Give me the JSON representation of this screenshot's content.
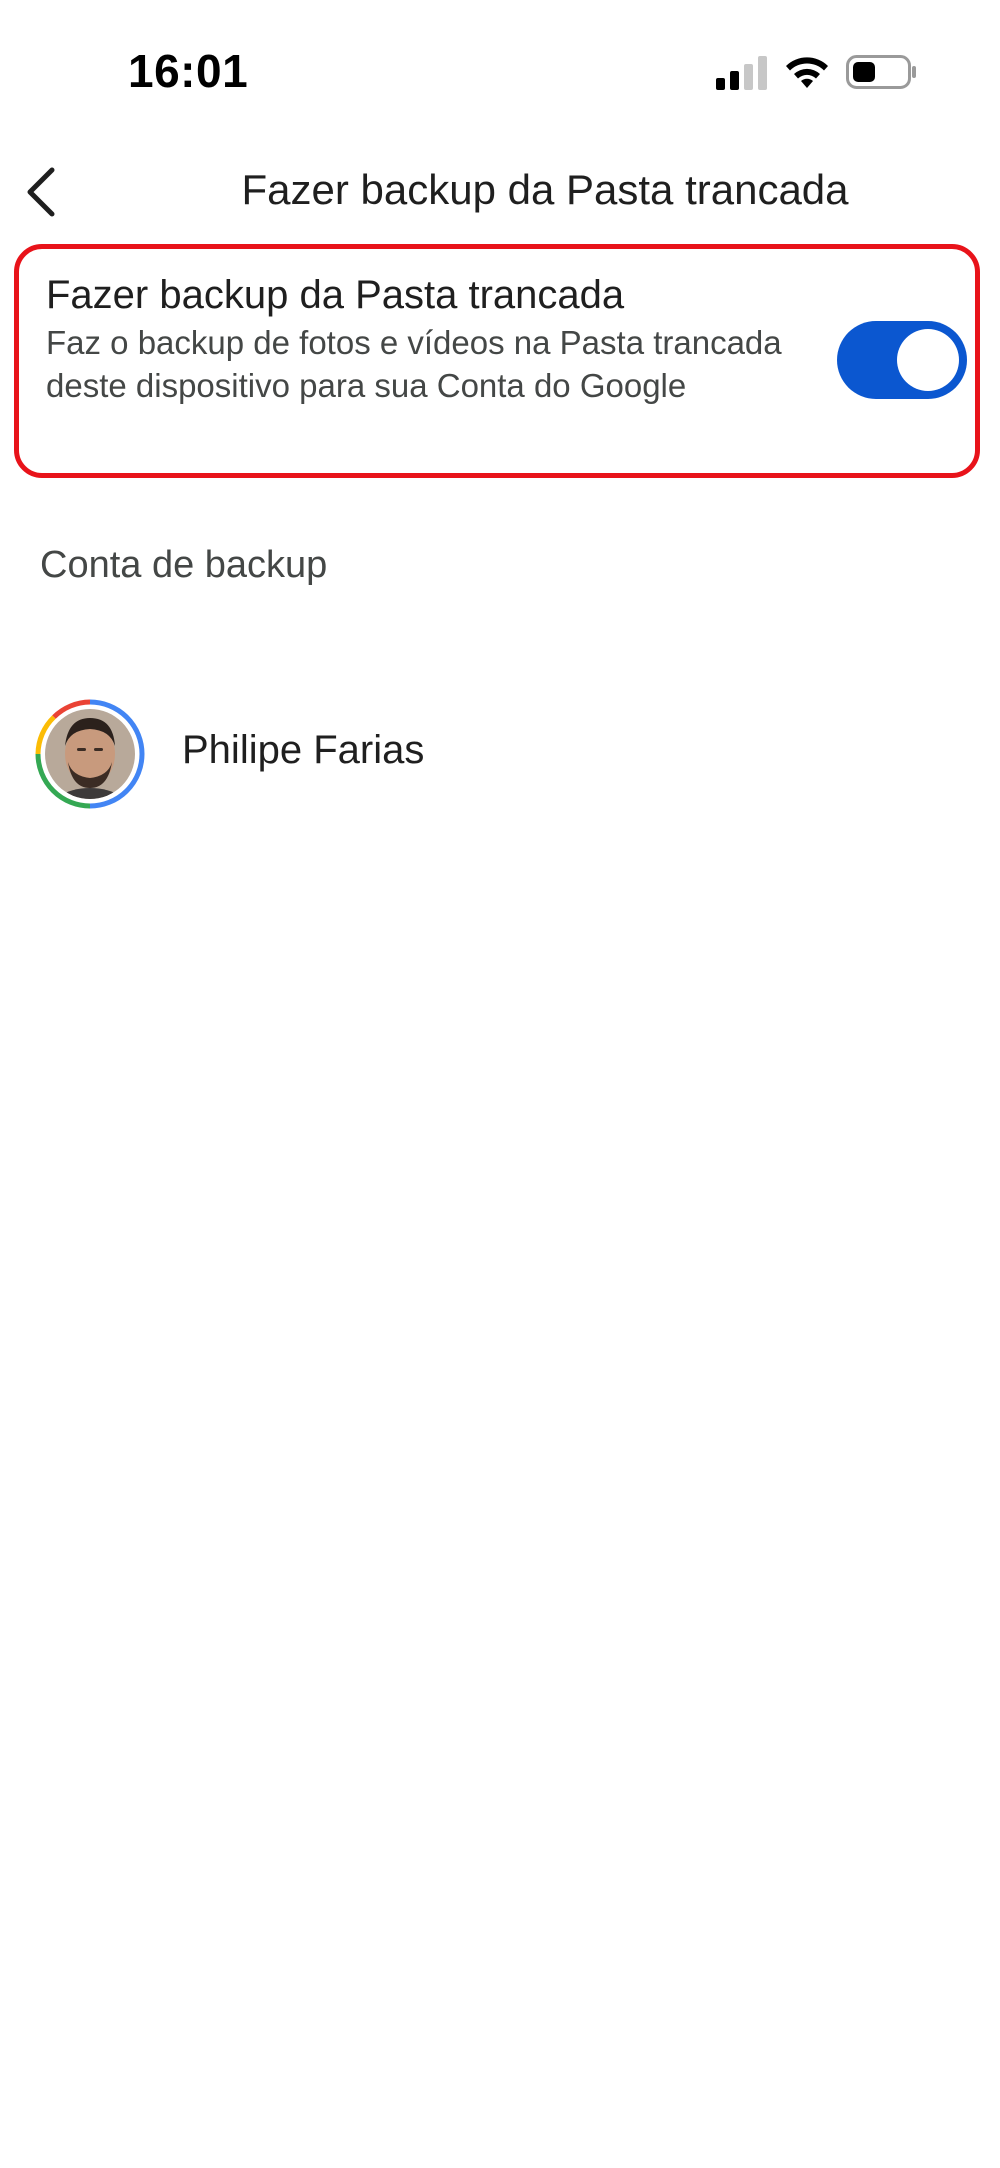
{
  "status_bar": {
    "time": "16:01",
    "icons": [
      "signal-icon",
      "wifi-icon",
      "battery-icon"
    ]
  },
  "header": {
    "back_icon": "chevron-left-icon",
    "title": "Fazer backup da Pasta trancada"
  },
  "backup_setting": {
    "title": "Fazer backup da Pasta trancada",
    "description": "Faz o backup de fotos e vídeos na Pasta trancada deste dispositivo para sua Conta do Google",
    "toggle_on": true,
    "toggle_color": "#0b57d0",
    "highlight_color": "#e8131a"
  },
  "account_section": {
    "label": "Conta de backup",
    "account": {
      "name": "Philipe Farias",
      "avatar_icon": "avatar-photo"
    }
  }
}
